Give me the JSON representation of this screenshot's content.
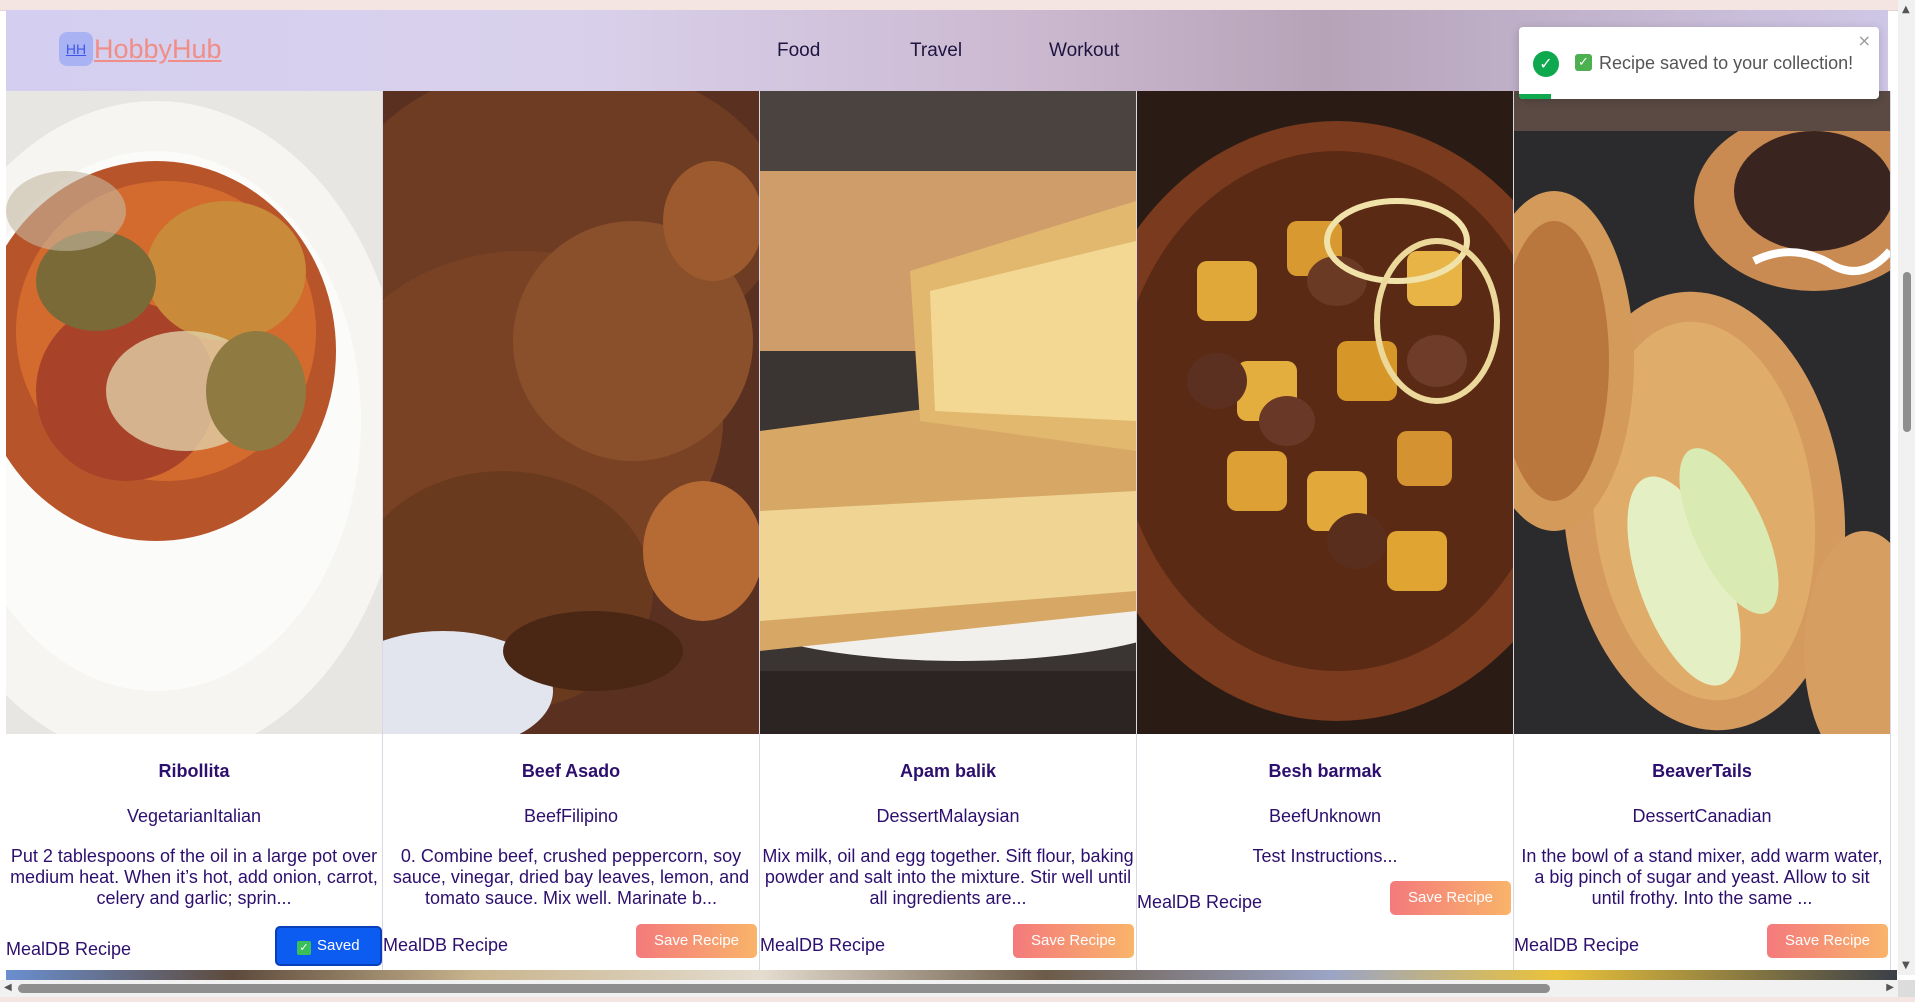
{
  "header": {
    "logo_badge": "HH",
    "logo_text": "HobbyHub",
    "nav": [
      "Food",
      "Travel",
      "Workout"
    ]
  },
  "toast": {
    "message": "Recipe saved to your collection!",
    "close": "×",
    "progress_fraction": 0.09
  },
  "recipes": [
    {
      "title": "Ribollita",
      "category": "VegetarianItalian",
      "description": "Put 2 tablespoons of the oil in a large pot over medium heat. When it’s hot, add onion, carrot, celery and garlic; sprin...",
      "source": "MealDB Recipe",
      "button": "Saved",
      "saved": true
    },
    {
      "title": "Beef Asado",
      "category": "BeefFilipino",
      "description": "0. Combine beef, crushed peppercorn, soy sauce, vinegar, dried bay leaves, lemon, and tomato sauce. Mix well. Marinate b...",
      "source": "MealDB Recipe",
      "button": "Save Recipe",
      "saved": false
    },
    {
      "title": "Apam balik",
      "category": "DessertMalaysian",
      "description": "Mix milk, oil and egg together. Sift flour, baking powder and salt into the mixture. Stir well until all ingredients are...",
      "source": "MealDB Recipe",
      "button": "Save Recipe",
      "saved": false
    },
    {
      "title": "Besh barmak",
      "category": "BeefUnknown",
      "description": "Test Instructions...",
      "source": "MealDB Recipe",
      "button": "Save Recipe",
      "saved": false
    },
    {
      "title": "BeaverTails",
      "category": "DessertCanadian",
      "description": "In the bowl of a stand mixer, add warm water, a big pinch of sugar and yeast. Allow to sit until frothy. Into the same ...",
      "source": "MealDB Recipe",
      "button": "Save Recipe",
      "saved": false
    }
  ],
  "colors": {
    "title_text": "#2d0f6e",
    "save_gradient_start": "#f47a7c",
    "save_gradient_end": "#f9b46a",
    "saved_button": "#0d5cf2",
    "toast_success": "#0ea84e"
  }
}
